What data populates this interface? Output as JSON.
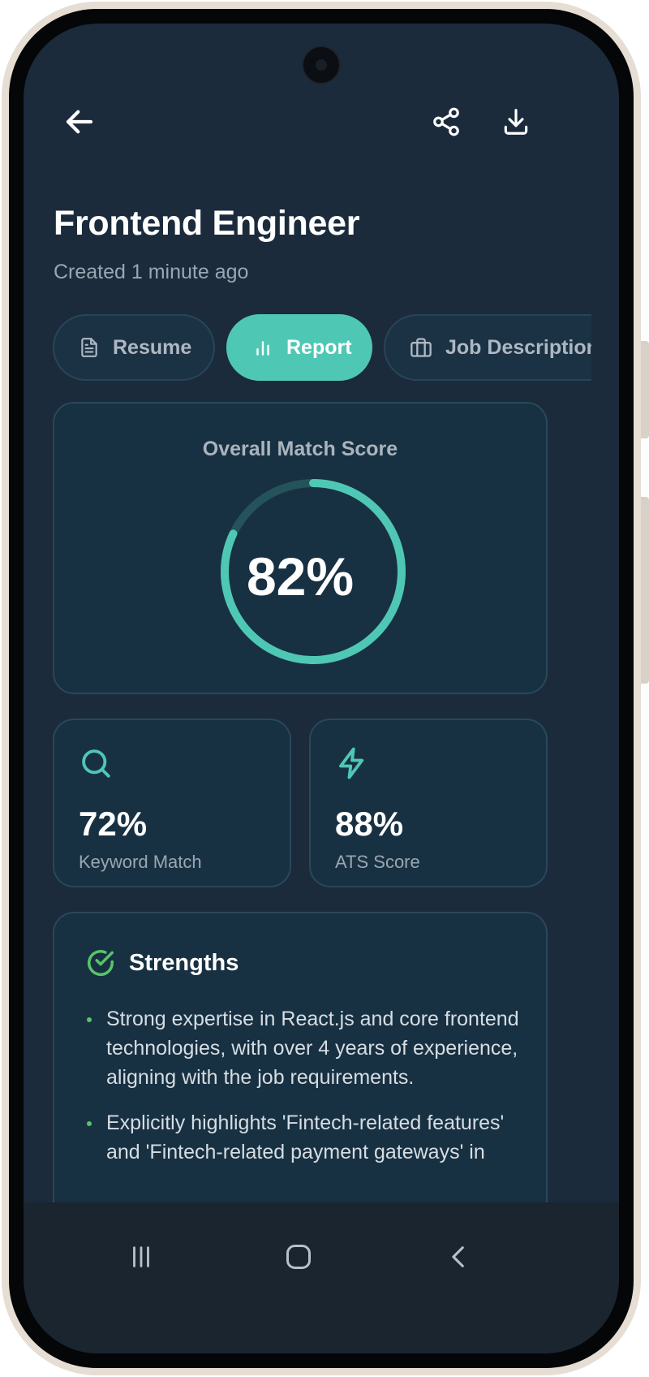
{
  "header": {
    "title": "Frontend Engineer",
    "subtitle": "Created 1 minute ago"
  },
  "icons": {
    "back": "arrow-left-icon",
    "share": "share-icon",
    "download": "download-icon"
  },
  "tabs": [
    {
      "label": "Resume",
      "icon": "document-icon",
      "active": false
    },
    {
      "label": "Report",
      "icon": "bar-chart-icon",
      "active": true
    },
    {
      "label": "Job Description",
      "icon": "briefcase-icon",
      "active": false
    }
  ],
  "overall": {
    "label": "Overall Match Score",
    "value_text": "82%",
    "value": 82
  },
  "metrics": [
    {
      "value": "72%",
      "label": "Keyword Match",
      "icon": "search-icon"
    },
    {
      "value": "88%",
      "label": "ATS Score",
      "icon": "lightning-icon"
    }
  ],
  "strengths": {
    "title": "Strengths",
    "icon": "check-circle-icon",
    "items": [
      "Strong expertise in React.js and core frontend technologies, with over 4 years of experience, aligning with the job requirements.",
      "Explicitly highlights 'Fintech-related features' and 'Fintech-related payment gateways' in"
    ]
  },
  "colors": {
    "background": "#1b2b3c",
    "accent": "#4fc7b5",
    "card": "#183142",
    "success": "#57c56a"
  },
  "nav": {
    "recents": "recents-icon",
    "home": "home-icon",
    "back": "back-chevron-icon"
  }
}
